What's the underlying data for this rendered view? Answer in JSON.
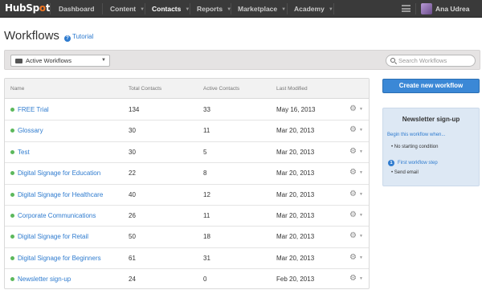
{
  "brand": {
    "logo_prefix": "HubSp",
    "logo_dot": "o",
    "logo_suffix": "t",
    "accent": "#f57722"
  },
  "nav": {
    "items": [
      {
        "label": "Dashboard"
      },
      {
        "label": "Content"
      },
      {
        "label": "Contacts"
      },
      {
        "label": "Reports"
      },
      {
        "label": "Marketplace"
      },
      {
        "label": "Academy"
      }
    ],
    "caret": "▼",
    "active_item": "Contacts",
    "user_name": "Ana Udrea"
  },
  "page": {
    "title": "Workflows",
    "tutorial_icon": "?",
    "tutorial_label": "Tutorial"
  },
  "filter": {
    "selected": "Active Workflows",
    "caret": "▼",
    "search_placeholder": "Search Workflows"
  },
  "table": {
    "columns": [
      "Name",
      "Total Contacts",
      "Active Contacts",
      "Last Modified"
    ],
    "gear_glyph": "⚙",
    "gear_caret": "▼",
    "rows": [
      {
        "name": "FREE Trial",
        "total": "134",
        "active": "33",
        "modified": "May 16, 2013"
      },
      {
        "name": "Glossary",
        "total": "30",
        "active": "11",
        "modified": "Mar 20, 2013"
      },
      {
        "name": "Test",
        "total": "30",
        "active": "5",
        "modified": "Mar 20, 2013"
      },
      {
        "name": "Digital Signage for Education",
        "total": "22",
        "active": "8",
        "modified": "Mar 20, 2013"
      },
      {
        "name": "Digital Signage for Healthcare",
        "total": "40",
        "active": "12",
        "modified": "Mar 20, 2013"
      },
      {
        "name": "Corporate Communications",
        "total": "26",
        "active": "11",
        "modified": "Mar 20, 2013"
      },
      {
        "name": "Digital Signage for Retail",
        "total": "50",
        "active": "18",
        "modified": "Mar 20, 2013"
      },
      {
        "name": "Digital Signage for Beginners",
        "total": "61",
        "active": "31",
        "modified": "Mar 20, 2013"
      },
      {
        "name": "Newsletter sign-up",
        "total": "24",
        "active": "0",
        "modified": "Feb 20, 2013"
      }
    ],
    "status_color": "#5cb85c"
  },
  "sidebar": {
    "create_label": "Create new workflow",
    "preview": {
      "title": "Newsletter sign-up",
      "begin_label": "Begin this workflow when...",
      "condition": "• No starting condition",
      "step_number": "1",
      "step_label": "First workflow step",
      "step_action": "• Send email"
    }
  }
}
